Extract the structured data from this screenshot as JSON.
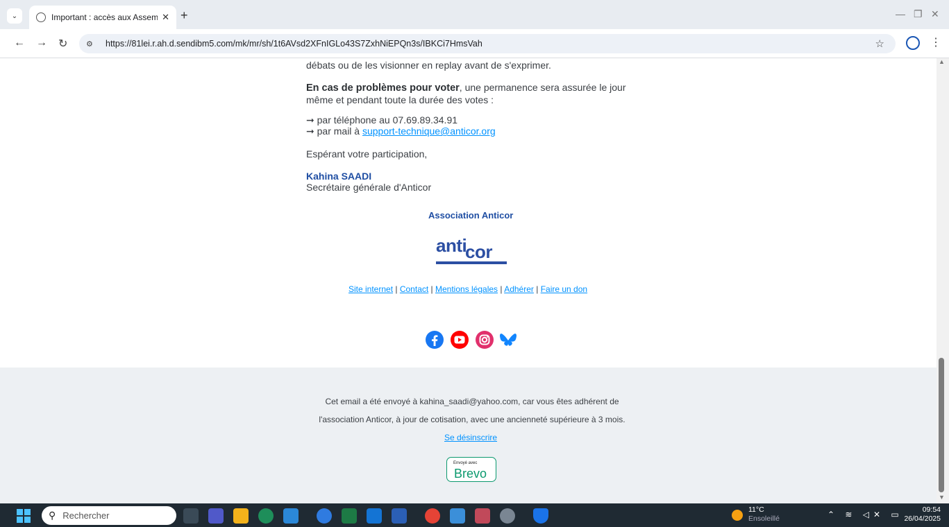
{
  "browser": {
    "tab_title": "Important : accès aux Assemblé",
    "url": "https://81lei.r.ah.d.sendibm5.com/mk/mr/sh/1t6AVsd2XFnIGLo43S7ZxhNiEPQn3s/IBKCi7HmsVah"
  },
  "email": {
    "p1": "débats ou de les visionner en replay avant de s'exprimer.",
    "p2_bold": "En cas de problèmes pour voter",
    "p2_rest": ", une permanence sera assurée le jour même et pendant toute la durée des votes :",
    "phone_line": "par téléphone au 07.69.89.34.91",
    "mail_prefix": "par mail à ",
    "mail_link": "support-technique@anticor.org",
    "closing": "Espérant votre participation,",
    "signer_name": "Kahina SAADI",
    "signer_title": "Secrétaire générale d'Anticor",
    "assoc": "Association Anticor",
    "logo_anti": "anti",
    "logo_cor": "cor",
    "links": [
      "Site internet",
      "Contact",
      "Mentions légales",
      "Adhérer",
      "Faire un don"
    ],
    "footer_line1": "Cet email a été envoyé à kahina_saadi@yahoo.com, car vous êtes adhérent de",
    "footer_line2": "l'association Anticor, à jour de cotisation, avec une ancienneté supérieure à 3 mois.",
    "unsubscribe": "Se désinscrire",
    "brevo_small": "Envoyé avec",
    "brevo_big": "Brevo"
  },
  "taskbar": {
    "search_placeholder": "Rechercher",
    "temp": "11°C",
    "weather": "Ensoleillé",
    "time": "09:54",
    "date": "26/04/2025"
  },
  "colors": {
    "link": "#0092ff",
    "brand_blue": "#1f4ea3",
    "brevo_green": "#0b996e"
  }
}
